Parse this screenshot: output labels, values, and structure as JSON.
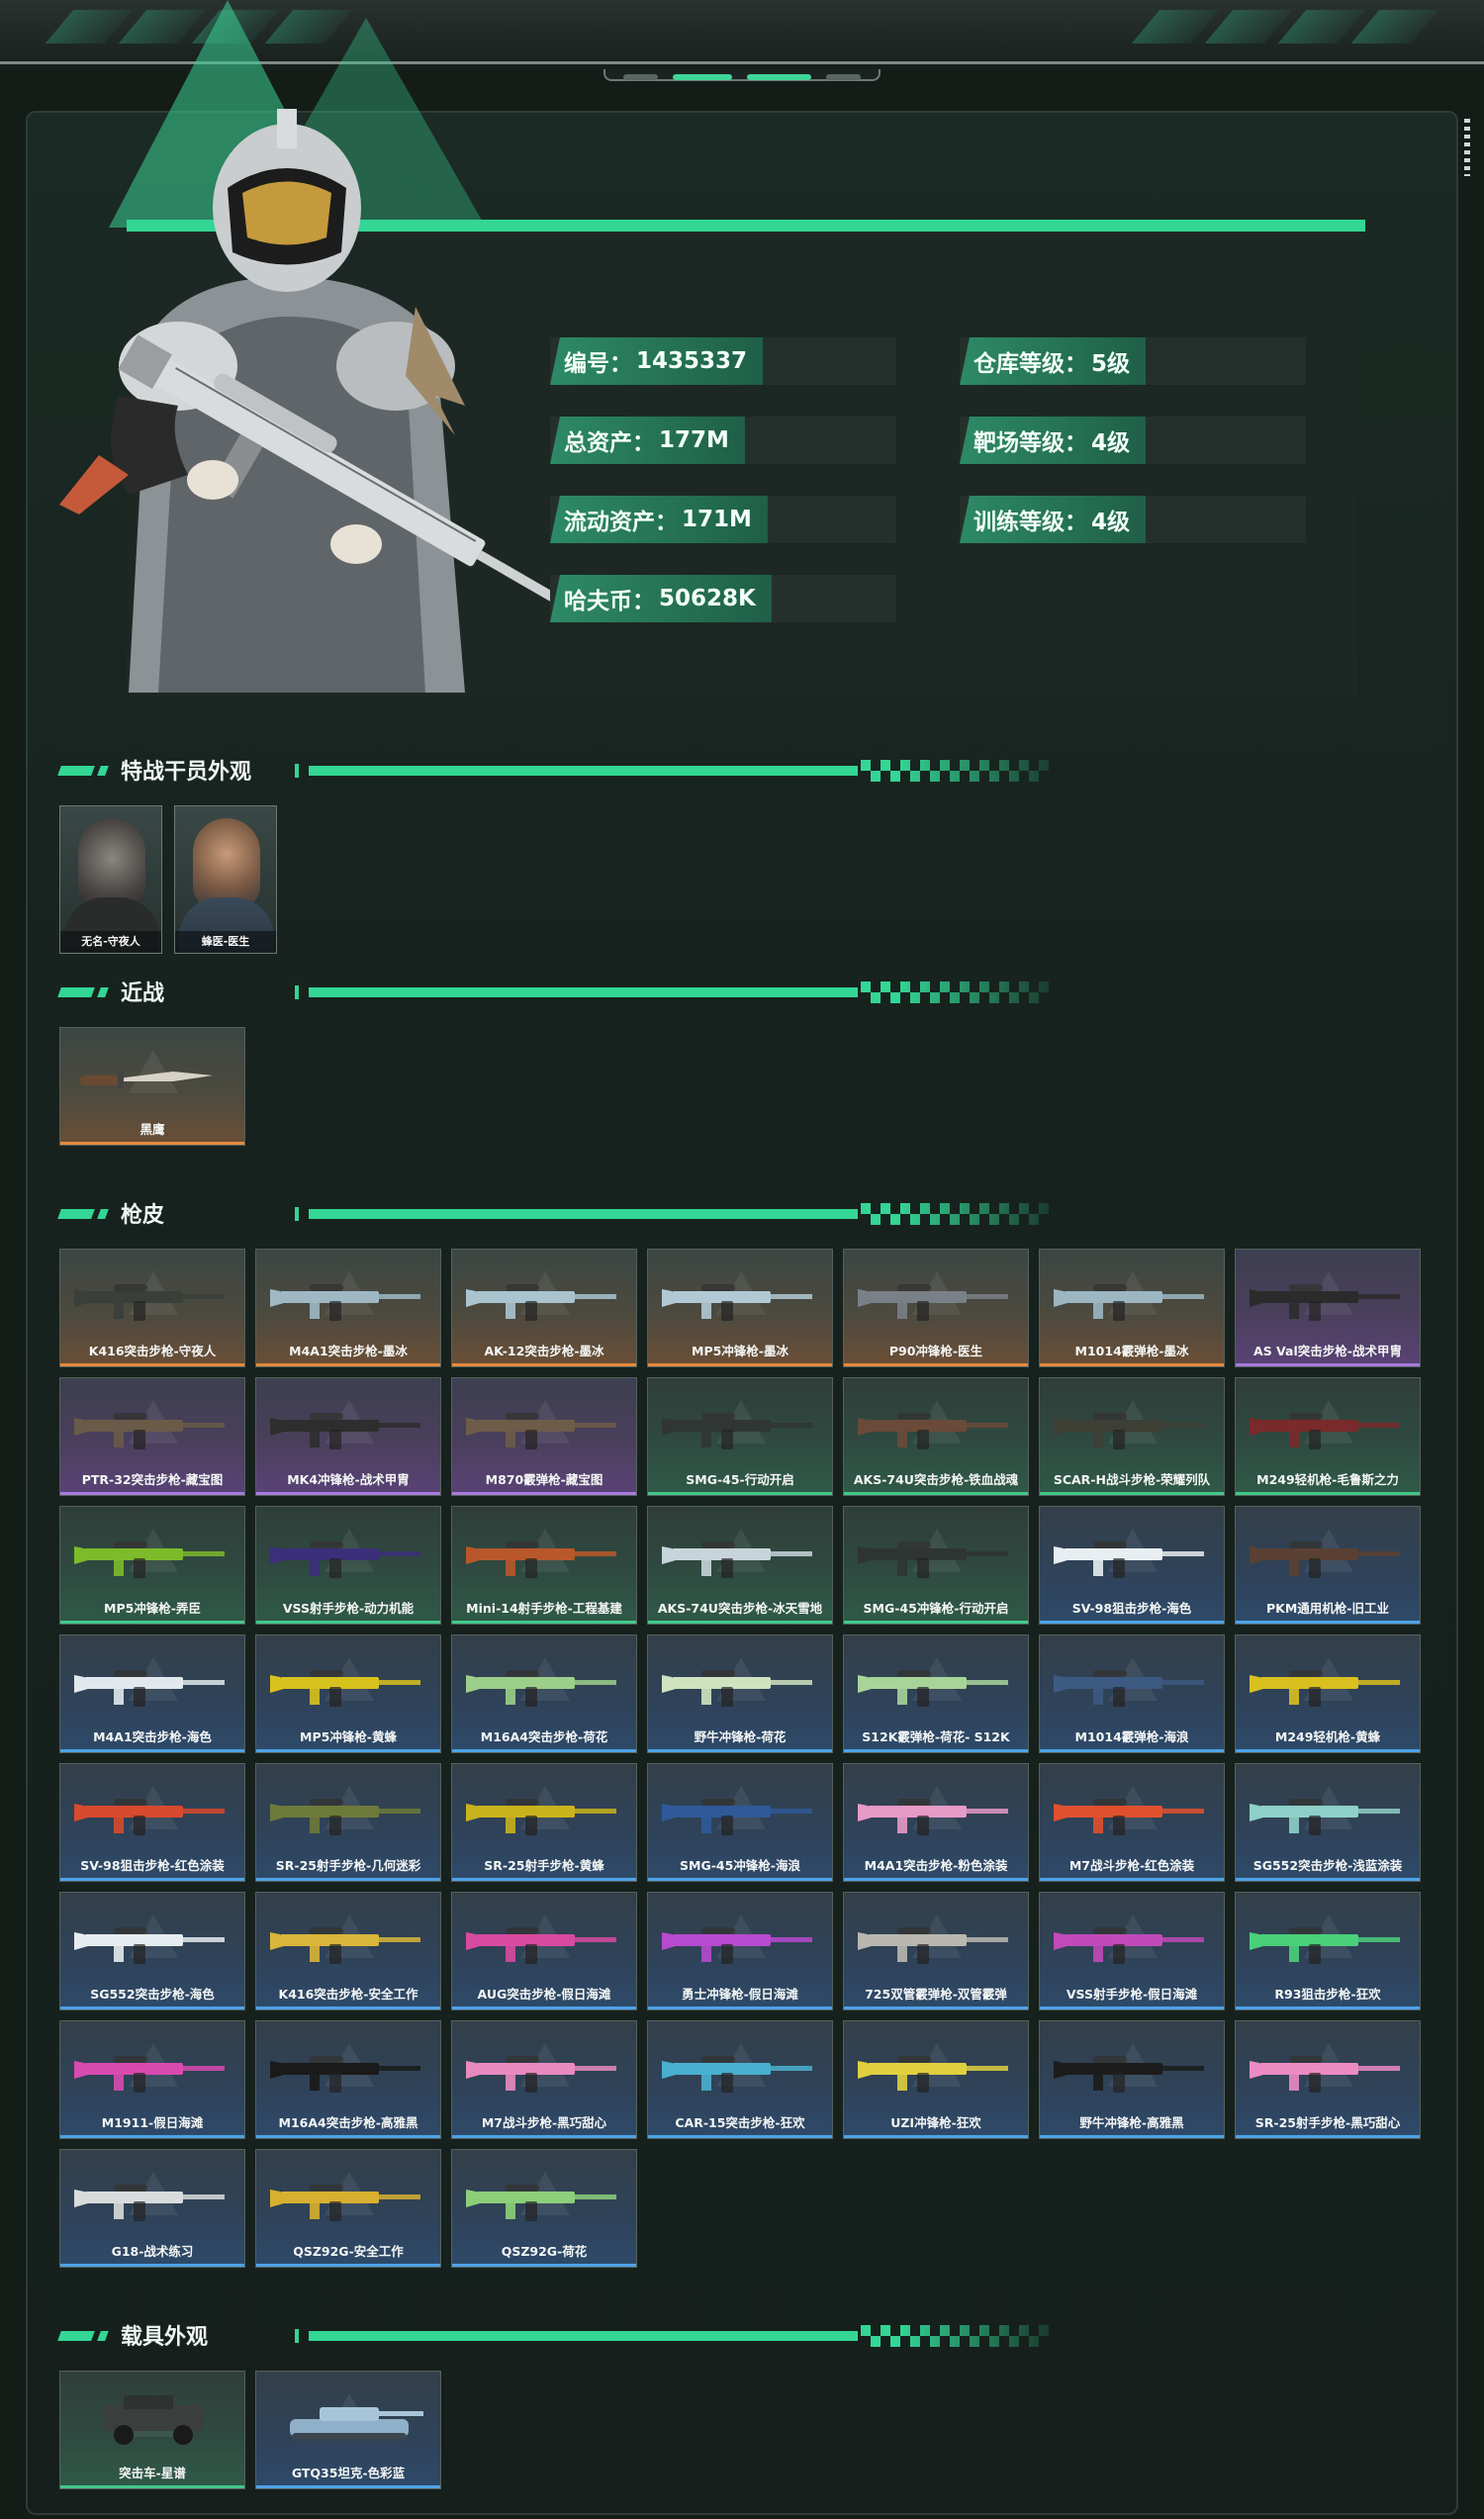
{
  "profile": {
    "stats_left": [
      {
        "label": "编号：",
        "value": "1435337"
      },
      {
        "label": "总资产：",
        "value": "177M"
      },
      {
        "label": "流动资产：",
        "value": "171M"
      },
      {
        "label": "哈夫币：",
        "value": "50628K"
      }
    ],
    "stats_right": [
      {
        "label": "仓库等级：",
        "value": "5级"
      },
      {
        "label": "靶场等级：",
        "value": "4级"
      },
      {
        "label": "训练等级：",
        "value": "4级"
      }
    ]
  },
  "sections": {
    "operators": {
      "title": "特战干员外观",
      "items": [
        {
          "name": "无名-守夜人",
          "icon": "operator-masked-portrait"
        },
        {
          "name": "蜂医-医生",
          "icon": "operator-medic-portrait"
        }
      ]
    },
    "melee": {
      "title": "近战",
      "items": [
        {
          "name": "黑鹰",
          "quality": "orange",
          "icon": "knife-icon"
        }
      ]
    },
    "weapons": {
      "title": "枪皮",
      "items": [
        {
          "name": "K416突击步枪-守夜人",
          "quality": "orange",
          "color": "#3a3f3a"
        },
        {
          "name": "M4A1突击步枪-墨冰",
          "quality": "orange",
          "color": "#9fb8c4"
        },
        {
          "name": "AK-12突击步枪-墨冰",
          "quality": "orange",
          "color": "#a9c3cf"
        },
        {
          "name": "MP5冲锋枪-墨冰",
          "quality": "orange",
          "color": "#b1c9d4"
        },
        {
          "name": "P90冲锋枪-医生",
          "quality": "orange",
          "color": "#7a8088"
        },
        {
          "name": "M1014霰弹枪-墨冰",
          "quality": "orange",
          "color": "#9cb6c2"
        },
        {
          "name": "AS Val突击步枪-战术甲胄",
          "quality": "purple",
          "color": "#2b2b2b"
        },
        {
          "name": "PTR-32突击步枪-藏宝图",
          "quality": "purple",
          "color": "#6a5a48"
        },
        {
          "name": "MK4冲锋枪-战术甲胄",
          "quality": "purple",
          "color": "#2e2e2e"
        },
        {
          "name": "M870霰弹枪-藏宝图",
          "quality": "purple",
          "color": "#6e5c49"
        },
        {
          "name": "SMG-45-行动开启",
          "quality": "green",
          "color": "#303633"
        },
        {
          "name": "AKS-74U突击步枪-铁血战魂",
          "quality": "green",
          "color": "#6a4a38"
        },
        {
          "name": "SCAR-H战斗步枪-荣耀列队",
          "quality": "green",
          "color": "#3e3f35"
        },
        {
          "name": "M249轻机枪-毛鲁斯之力",
          "quality": "green",
          "color": "#7a2a2a"
        },
        {
          "name": "MP5冲锋枪-弄臣",
          "quality": "green",
          "color": "#7dbb2a"
        },
        {
          "name": "VSS射手步枪-动力机能",
          "quality": "green",
          "color": "#3b2f7a"
        },
        {
          "name": "Mini-14射手步枪-工程基建",
          "quality": "green",
          "color": "#b8582a"
        },
        {
          "name": "AKS-74U突击步枪-冰天雪地",
          "quality": "green",
          "color": "#c8d4dc"
        },
        {
          "name": "SMG-45冲锋枪-行动开启",
          "quality": "green",
          "color": "#2f3532"
        },
        {
          "name": "SV-98狙击步枪-海色",
          "quality": "blue",
          "color": "#e8eef2"
        },
        {
          "name": "PKM通用机枪-旧工业",
          "quality": "blue",
          "color": "#5a4032"
        },
        {
          "name": "M4A1突击步枪-海色",
          "quality": "blue",
          "color": "#e2e9ee"
        },
        {
          "name": "MP5冲锋枪-黄蜂",
          "quality": "blue",
          "color": "#d8c21e"
        },
        {
          "name": "M16A4突击步枪-荷花",
          "quality": "blue",
          "color": "#9ccf8a"
        },
        {
          "name": "野牛冲锋枪-荷花",
          "quality": "blue",
          "color": "#cfe3c0"
        },
        {
          "name": "S12K霰弹枪-荷花- S12K",
          "quality": "blue",
          "color": "#a8d49a"
        },
        {
          "name": "M1014霰弹枪-海浪",
          "quality": "blue",
          "color": "#3d5a82"
        },
        {
          "name": "M249轻机枪-黄蜂",
          "quality": "blue",
          "color": "#d9c01f"
        },
        {
          "name": "SV-98狙击步枪-红色涂装",
          "quality": "blue",
          "color": "#d84a2e"
        },
        {
          "name": "SR-25射手步枪-几何迷彩",
          "quality": "blue",
          "color": "#6e7a3a"
        },
        {
          "name": "SR-25射手步枪-黄蜂",
          "quality": "blue",
          "color": "#c9b31c"
        },
        {
          "name": "SMG-45冲锋枪-海浪",
          "quality": "blue",
          "color": "#2f5a9a"
        },
        {
          "name": "M4A1突击步枪-粉色涂装",
          "quality": "blue",
          "color": "#e69ac8"
        },
        {
          "name": "M7战斗步枪-红色涂装",
          "quality": "blue",
          "color": "#e0502e"
        },
        {
          "name": "SG552突击步枪-浅蓝涂装",
          "quality": "blue",
          "color": "#8fd0c8"
        },
        {
          "name": "SG552突击步枪-海色",
          "quality": "blue",
          "color": "#e6ecf0"
        },
        {
          "name": "K416突击步枪-安全工作",
          "quality": "blue",
          "color": "#d9b53a"
        },
        {
          "name": "AUG突击步枪-假日海滩",
          "quality": "blue",
          "color": "#d84aa0"
        },
        {
          "name": "勇士冲锋枪-假日海滩",
          "quality": "blue",
          "color": "#b84ad0"
        },
        {
          "name": "725双管霰弹枪-双管霰弹",
          "quality": "blue",
          "color": "#b8b8b0"
        },
        {
          "name": "VSS射手步枪-假日海滩",
          "quality": "blue",
          "color": "#c04ab8"
        },
        {
          "name": "R93狙击步枪-狂欢",
          "quality": "blue",
          "color": "#4ad07a"
        },
        {
          "name": "M1911-假日海滩",
          "quality": "blue",
          "color": "#d84ab0"
        },
        {
          "name": "M16A4突击步枪-高雅黑",
          "quality": "blue",
          "color": "#1a1a1a"
        },
        {
          "name": "M7战斗步枪-黑巧甜心",
          "quality": "blue",
          "color": "#e88ac0"
        },
        {
          "name": "CAR-15突击步枪-狂欢",
          "quality": "blue",
          "color": "#4ab0d0"
        },
        {
          "name": "UZI冲锋枪-狂欢",
          "quality": "blue",
          "color": "#e0d040"
        },
        {
          "name": "野牛冲锋枪-高雅黑",
          "quality": "blue",
          "color": "#1c1c1c"
        },
        {
          "name": "SR-25射手步枪-黑巧甜心",
          "quality": "blue",
          "color": "#ec8ac4"
        },
        {
          "name": "G18-战术练习",
          "quality": "blue",
          "color": "#d8dcdc"
        },
        {
          "name": "QSZ92G-安全工作",
          "quality": "blue",
          "color": "#d8b030"
        },
        {
          "name": "QSZ92G-荷花",
          "quality": "blue",
          "color": "#8ccf7a"
        }
      ]
    },
    "vehicles": {
      "title": "载具外观",
      "items": [
        {
          "name": "突击车-星谱",
          "quality": "green",
          "color": "#3a3e3c"
        },
        {
          "name": "GTQ35坦克-色彩蓝",
          "quality": "blue",
          "color": "#8fb0c8"
        }
      ]
    }
  },
  "colors": {
    "accent": "#33d695",
    "panel": "#17221e",
    "quality_orange": "#e58a3d",
    "quality_purple": "#a87be0",
    "quality_green": "#43c98a",
    "quality_blue": "#4ea3e8"
  }
}
